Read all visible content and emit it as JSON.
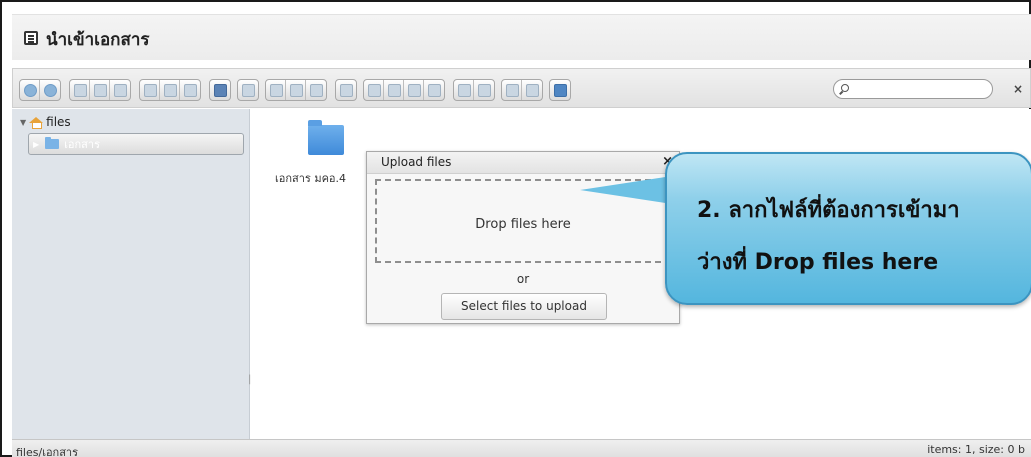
{
  "header": {
    "title": "นำเข้าเอกสาร",
    "icon": "document-list-icon"
  },
  "toolbar": {
    "groups": [
      [
        "back",
        "forward"
      ],
      [
        "home",
        "reload",
        "save"
      ],
      [
        "open",
        "download",
        "select"
      ],
      [
        "info"
      ],
      [
        "view"
      ],
      [
        "copy",
        "cut",
        "paste"
      ],
      [
        "duplicate"
      ],
      [
        "new-file",
        "new-folder",
        "rename",
        "extract"
      ],
      [
        "archive",
        "resize"
      ],
      [
        "list-view",
        "icons-view"
      ],
      [
        "help"
      ]
    ],
    "search": {
      "placeholder": "",
      "clear_label": "×"
    }
  },
  "sidebar": {
    "root": {
      "label": "files"
    },
    "children": [
      {
        "label": "เอกสาร"
      }
    ],
    "resize_handle": "||"
  },
  "main": {
    "items": [
      {
        "label": "เอกสาร มคอ.4",
        "type": "folder"
      }
    ]
  },
  "dialog": {
    "title": "Upload files",
    "close_label": "×",
    "dropzone_text": "Drop files here",
    "or_text": "or",
    "upload_button": "Select files to upload"
  },
  "callout": {
    "line1": "2. ลากไฟล์ที่ต้องการเข้ามา",
    "line2": "ว่างที่ Drop files here"
  },
  "statusbar": {
    "path": "files/เอกสาร",
    "info": "items: 1, size: 0 b"
  },
  "colors": {
    "callout_fill": "#54b6de",
    "folder": "#3f8ad9",
    "sidebar_bg": "#dfe4ea"
  }
}
